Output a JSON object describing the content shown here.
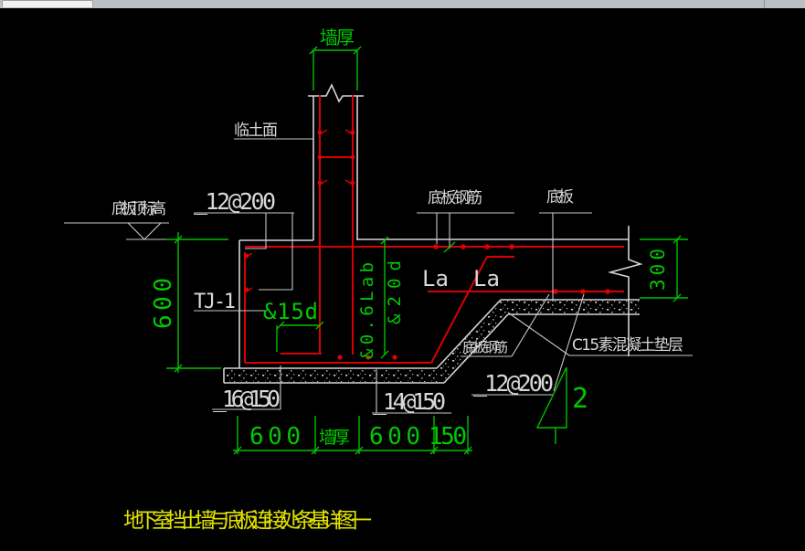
{
  "window": {
    "bar_color": "#bcc0c4",
    "tab_color": "#f2f2f2"
  },
  "colors": {
    "background": "#000000",
    "outline": "#d4d4d4",
    "rebar": "#d80000",
    "dimension": "#00c000",
    "title": "#e0e000"
  },
  "drawing": {
    "title": "地下室挡土墙与底板连接处条基详图一",
    "labels": {
      "wall_thickness_top": "墙厚",
      "soil_face": "临土面",
      "slab_top_elevation": "底板顶标高",
      "wall_rebar": "_12@200",
      "slab_rebar_top": "底板钢筋",
      "slab": "底板",
      "footing_id": "TJ-1",
      "hook_min": "&15d",
      "anchor_lab": "&0.6Lab",
      "anchor_20d": "&20d",
      "la_left": "La",
      "la_right": "La",
      "slab_rebar_bottom": "底板钢筋",
      "slab_bottom_rebar_spec": "_12@200",
      "cushion": "C15素混凝土垫层",
      "footing_bottom_rebar": "_16@150",
      "footing_mid_rebar": "_14@150",
      "slope_number": "2"
    },
    "dims": {
      "footing_height": "600",
      "slab_thickness": "300",
      "bottom_600_left": "600",
      "bottom_wall_thickness": "墙厚",
      "bottom_600_right": "600",
      "bottom_150": "150"
    }
  }
}
